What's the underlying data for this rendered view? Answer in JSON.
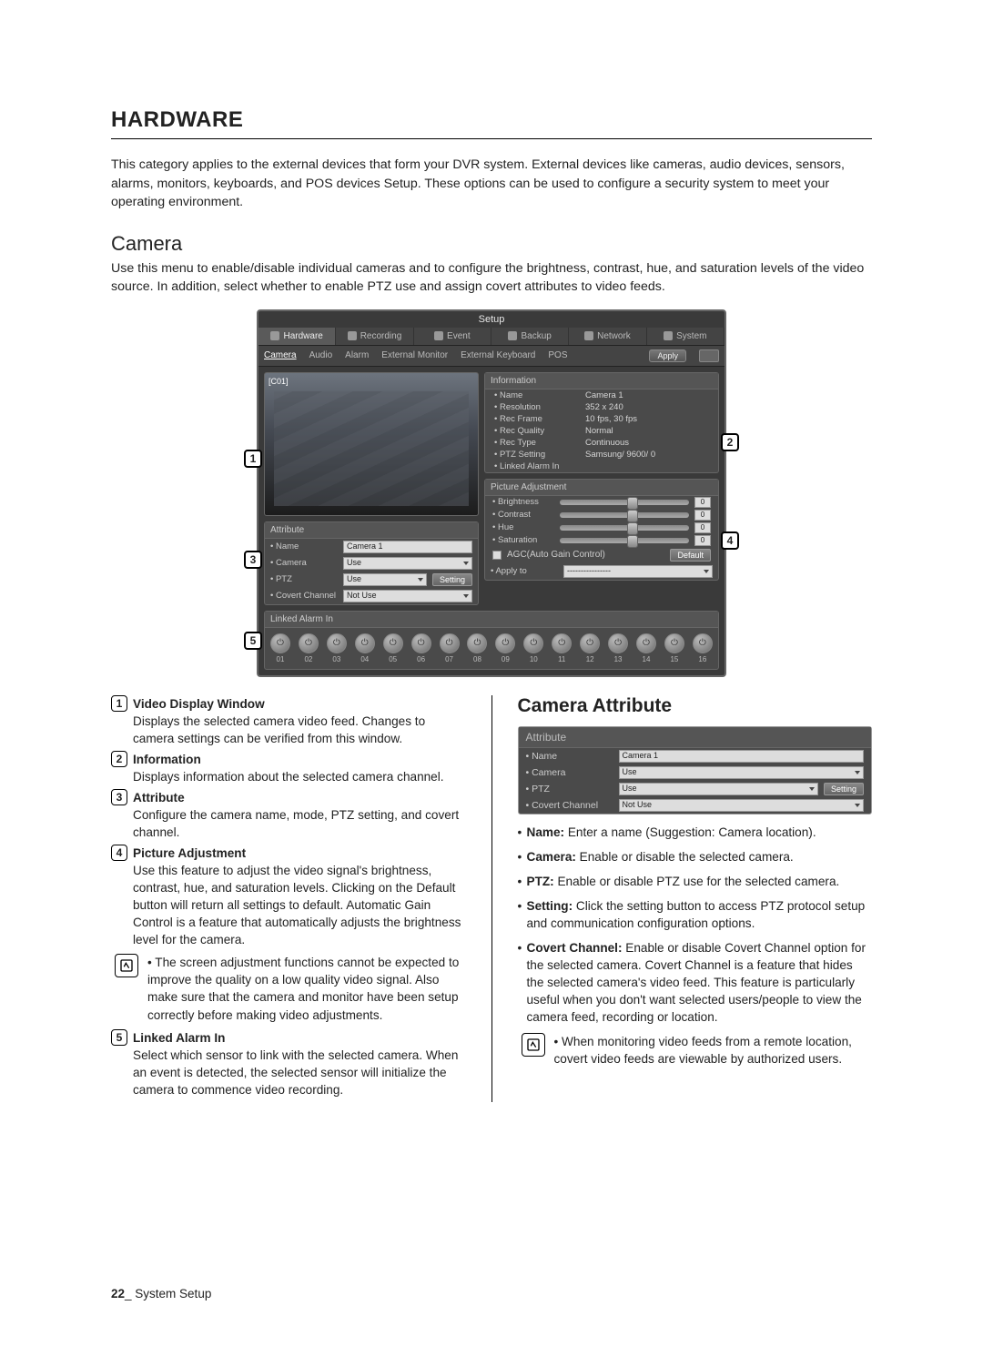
{
  "page": {
    "title": "HARDWARE",
    "intro": "This category applies to the external devices that form your DVR system. External devices like cameras, audio devices, sensors, alarms, monitors, keyboards, and POS devices Setup. These options can be used to configure a security system to meet your operating environment.",
    "section_title": "Camera",
    "section_desc": "Use this menu to enable/disable individual cameras and to configure the brightness, contrast, hue, and saturation levels of the video source. In addition, select whether to enable PTZ use and assign covert attributes to video feeds."
  },
  "setup": {
    "window_title": "Setup",
    "main_tabs": [
      "Hardware",
      "Recording",
      "Event",
      "Backup",
      "Network",
      "System"
    ],
    "sub_tabs_left": [
      "Camera",
      "Audio",
      "Alarm",
      "External Monitor"
    ],
    "sub_tabs_right": [
      "External Keyboard",
      "POS"
    ],
    "apply_label": "Apply",
    "video_label": "[C01]",
    "attribute": {
      "header": "Attribute",
      "name_label": "Name",
      "name_value": "Camera 1",
      "camera_label": "Camera",
      "camera_value": "Use",
      "ptz_label": "PTZ",
      "ptz_value": "Use",
      "setting_btn": "Setting",
      "covert_label": "Covert Channel",
      "covert_value": "Not Use"
    },
    "information": {
      "header": "Information",
      "rows": [
        {
          "k": "Name",
          "v": "Camera 1"
        },
        {
          "k": "Resolution",
          "v": "352 x 240"
        },
        {
          "k": "Rec Frame",
          "v": "10 fps, 30 fps"
        },
        {
          "k": "Rec Quality",
          "v": "Normal"
        },
        {
          "k": "Rec Type",
          "v": "Continuous"
        },
        {
          "k": "PTZ Setting",
          "v": "Samsung/ 9600/ 0"
        },
        {
          "k": "Linked Alarm In",
          "v": ""
        }
      ]
    },
    "picture": {
      "header": "Picture Adjustment",
      "sliders": [
        "Brightness",
        "Contrast",
        "Hue",
        "Saturation"
      ],
      "slider_value": "0",
      "agc_label": "AGC(Auto Gain Control)",
      "default_btn": "Default",
      "apply_to_label": "Apply to"
    },
    "linked": {
      "header": "Linked Alarm In",
      "count": 16,
      "icon_glyph": "⏻"
    }
  },
  "callouts": [
    "1",
    "2",
    "3",
    "4",
    "5"
  ],
  "exp_left": [
    {
      "n": "1",
      "title": "Video Display Window",
      "body": "Displays the selected camera video feed. Changes to camera settings can be verified from this window."
    },
    {
      "n": "2",
      "title": "Information",
      "body": "Displays information about the selected camera channel."
    },
    {
      "n": "3",
      "title": "Attribute",
      "body": "Configure the camera name, mode, PTZ setting, and covert channel."
    },
    {
      "n": "4",
      "title": "Picture Adjustment",
      "body": "Use this feature to adjust the video signal's brightness, contrast, hue, and saturation levels. Clicking on the Default button will return all settings to default. Automatic Gain Control is a feature that automatically adjusts the brightness level for the camera."
    }
  ],
  "exp_left_note": "The screen adjustment functions cannot be expected to improve the quality on a low quality video signal. Also make sure that the camera and monitor have been setup correctly before making video adjustments.",
  "exp_left_5": {
    "n": "5",
    "title": "Linked Alarm In",
    "body": "Select which sensor to link with the selected camera. When an event is detected, the selected sensor will initialize the camera to commence video recording."
  },
  "right": {
    "heading": "Camera Attribute",
    "bullets": [
      {
        "b": "Name:",
        "t": " Enter a name (Suggestion: Camera location)."
      },
      {
        "b": "Camera:",
        "t": " Enable or disable the selected camera."
      },
      {
        "b": "PTZ:",
        "t": " Enable or disable PTZ use for the selected camera."
      },
      {
        "b": "Setting:",
        "t": " Click the setting button to access PTZ protocol setup and communication configuration options."
      },
      {
        "b": "Covert Channel:",
        "t": " Enable or disable Covert Channel option for the selected camera. Covert Channel is a feature that hides the selected camera's video feed. This feature is particularly useful when you don't want selected users/people to view the camera feed, recording or location."
      }
    ],
    "note": "When monitoring video feeds from a remote location, covert video feeds are viewable by authorized users."
  },
  "footer": {
    "page": "22",
    "section": "_ System Setup"
  }
}
